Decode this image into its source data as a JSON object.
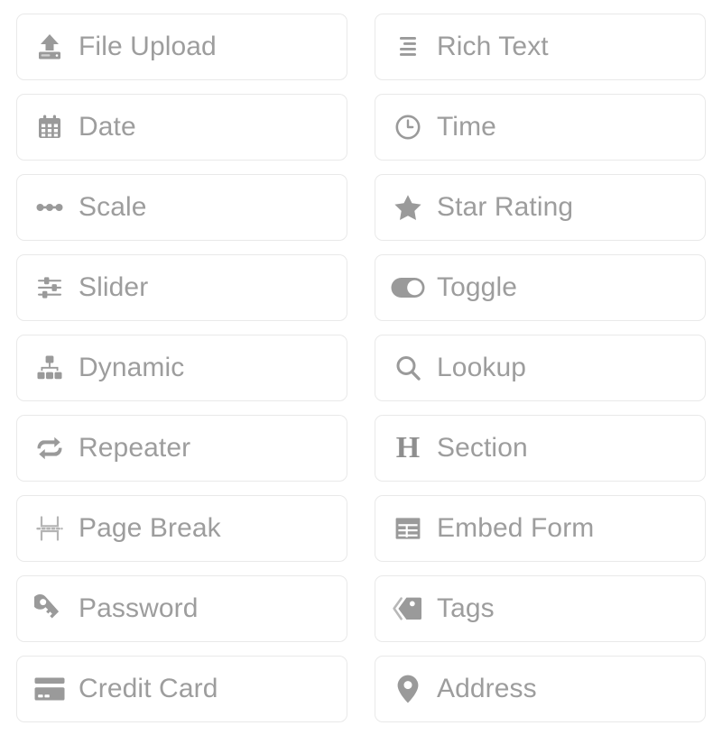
{
  "palette": {
    "icon_color": "#9a9a9a",
    "label_color": "#9d9d9d",
    "card_border_color": "#e9e9e9",
    "card_background": "#ffffff",
    "columns": 2,
    "items": [
      {
        "label": "File Upload",
        "icon": "file-upload-icon",
        "column": "left"
      },
      {
        "label": "Rich Text",
        "icon": "align-left-icon",
        "column": "right"
      },
      {
        "label": "Date",
        "icon": "calendar-icon",
        "column": "left"
      },
      {
        "label": "Time",
        "icon": "clock-icon",
        "column": "right"
      },
      {
        "label": "Scale",
        "icon": "scale-dots-icon",
        "column": "left"
      },
      {
        "label": "Star Rating",
        "icon": "star-icon",
        "column": "right"
      },
      {
        "label": "Slider",
        "icon": "sliders-icon",
        "column": "left"
      },
      {
        "label": "Toggle",
        "icon": "toggle-on-icon",
        "column": "right"
      },
      {
        "label": "Dynamic",
        "icon": "sitemap-icon",
        "column": "left"
      },
      {
        "label": "Lookup",
        "icon": "search-icon",
        "column": "right"
      },
      {
        "label": "Repeater",
        "icon": "repeat-arrows-icon",
        "column": "left"
      },
      {
        "label": "Section",
        "icon": "heading-h-icon",
        "column": "right"
      },
      {
        "label": "Page Break",
        "icon": "page-break-icon",
        "column": "left"
      },
      {
        "label": "Embed Form",
        "icon": "table-grid-icon",
        "column": "right"
      },
      {
        "label": "Password",
        "icon": "key-icon",
        "column": "left"
      },
      {
        "label": "Tags",
        "icon": "tag-icon",
        "column": "right"
      },
      {
        "label": "Credit Card",
        "icon": "credit-card-icon",
        "column": "left"
      },
      {
        "label": "Address",
        "icon": "map-pin-icon",
        "column": "right"
      }
    ],
    "glyphs": {
      "heading_h": "H"
    }
  }
}
